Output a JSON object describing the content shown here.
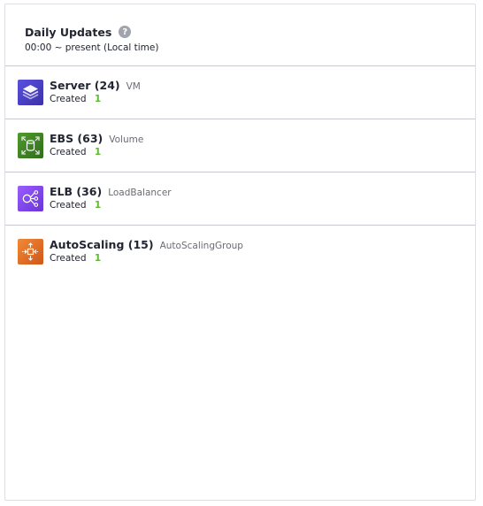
{
  "header": {
    "title": "Daily Updates",
    "help_glyph": "?",
    "subtitle": "00:00 ~ present (Local time)"
  },
  "resources": [
    {
      "name": "Server (24)",
      "type": "VM",
      "status_label": "Created",
      "count": "1",
      "icon": "server-stack-icon",
      "icon_color": "#4a3fc3"
    },
    {
      "name": "EBS (63)",
      "type": "Volume",
      "status_label": "Created",
      "count": "1",
      "icon": "volume-cylinder-icon",
      "icon_color": "#3f8624"
    },
    {
      "name": "ELB (36)",
      "type": "LoadBalancer",
      "status_label": "Created",
      "count": "1",
      "icon": "load-balancer-icon",
      "icon_color": "#8c4fff"
    },
    {
      "name": "AutoScaling (15)",
      "type": "AutoScalingGroup",
      "status_label": "Created",
      "count": "1",
      "icon": "autoscaling-icon",
      "icon_color": "#e36b1f"
    }
  ],
  "colors": {
    "count_green": "#60b731",
    "divider": "#c6c8cf",
    "text": "#222532",
    "muted": "#6a6c75"
  }
}
